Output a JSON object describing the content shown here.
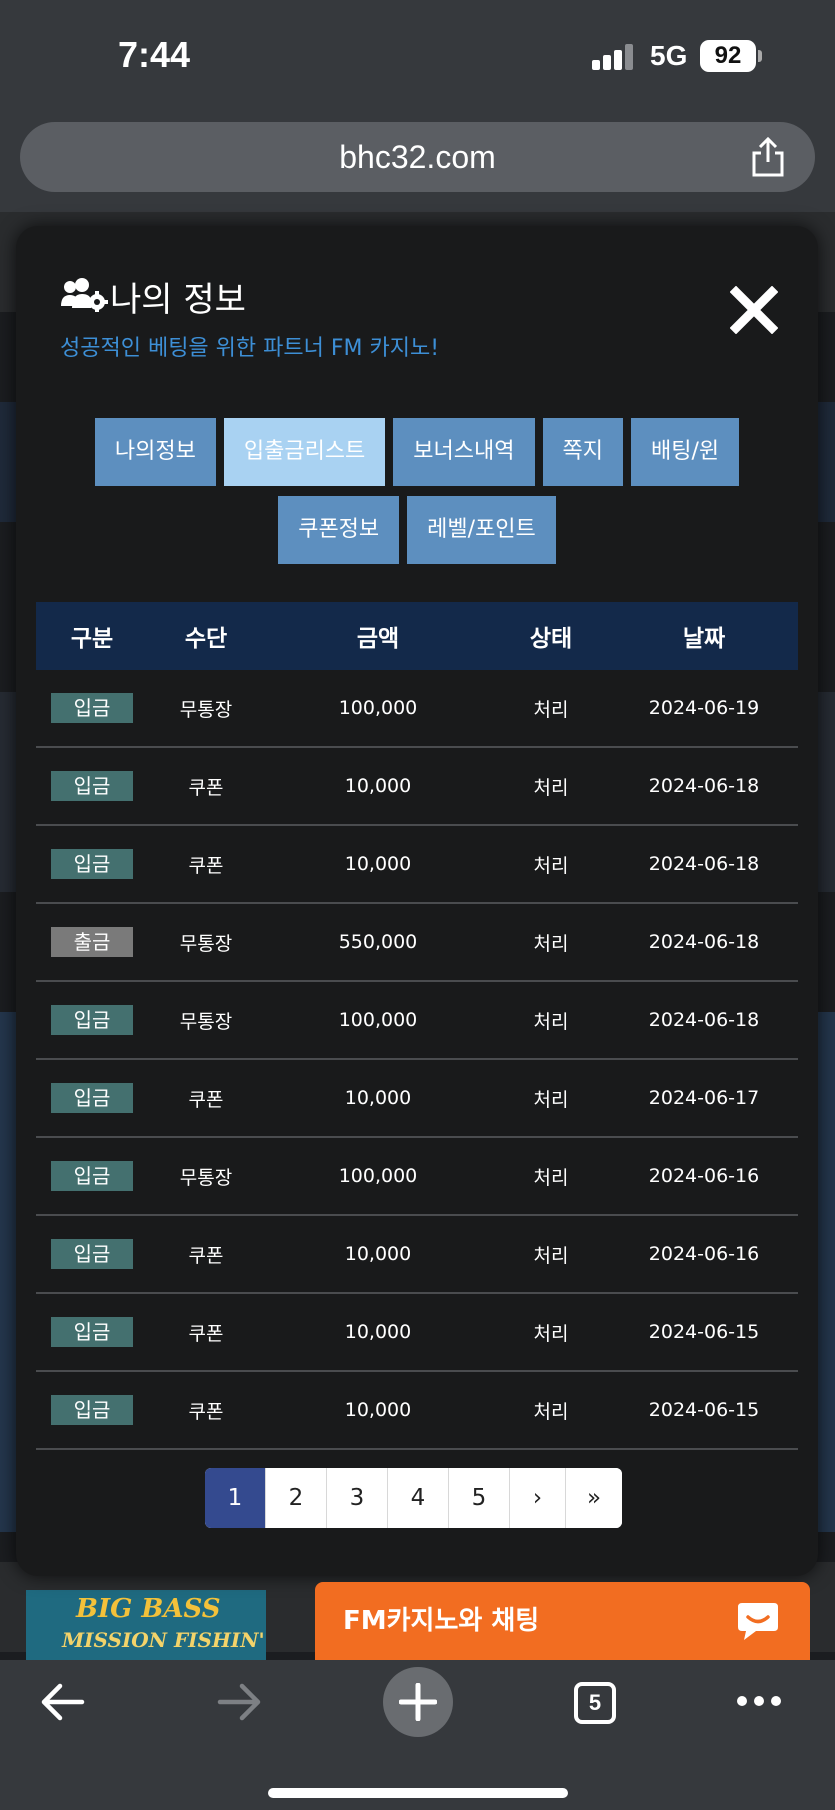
{
  "status_bar": {
    "time": "7:44",
    "network": "5G",
    "battery": "92"
  },
  "browser": {
    "url": "bhc32.com",
    "tab_count": "5"
  },
  "modal": {
    "title": "나의 정보",
    "subtitle": "성공적인 베팅을 위한 파트너 FM 카지노!",
    "tabs_row1": [
      "나의정보",
      "입출금리스트",
      "보너스내역",
      "쪽지",
      "배팅/윈"
    ],
    "tabs_row2": [
      "쿠폰정보",
      "레벨/포인트"
    ],
    "active_tab": "입출금리스트"
  },
  "table": {
    "headers": [
      "구분",
      "수단",
      "금액",
      "상태",
      "날짜"
    ],
    "rows": [
      {
        "type": "입금",
        "method": "무통장",
        "amount": "100,000",
        "status": "처리",
        "date": "2024-06-19"
      },
      {
        "type": "입금",
        "method": "쿠폰",
        "amount": "10,000",
        "status": "처리",
        "date": "2024-06-18"
      },
      {
        "type": "입금",
        "method": "쿠폰",
        "amount": "10,000",
        "status": "처리",
        "date": "2024-06-18"
      },
      {
        "type": "출금",
        "method": "무통장",
        "amount": "550,000",
        "status": "처리",
        "date": "2024-06-18"
      },
      {
        "type": "입금",
        "method": "무통장",
        "amount": "100,000",
        "status": "처리",
        "date": "2024-06-18"
      },
      {
        "type": "입금",
        "method": "쿠폰",
        "amount": "10,000",
        "status": "처리",
        "date": "2024-06-17"
      },
      {
        "type": "입금",
        "method": "무통장",
        "amount": "100,000",
        "status": "처리",
        "date": "2024-06-16"
      },
      {
        "type": "입금",
        "method": "쿠폰",
        "amount": "10,000",
        "status": "처리",
        "date": "2024-06-16"
      },
      {
        "type": "입금",
        "method": "쿠폰",
        "amount": "10,000",
        "status": "처리",
        "date": "2024-06-15"
      },
      {
        "type": "입금",
        "method": "쿠폰",
        "amount": "10,000",
        "status": "처리",
        "date": "2024-06-15"
      }
    ]
  },
  "pagination": {
    "pages": [
      "1",
      "2",
      "3",
      "4",
      "5"
    ],
    "next": "›",
    "last": "»",
    "current": "1"
  },
  "chat": {
    "label": "FM카지노와 채팅"
  },
  "background": {
    "banner_line1": "BIG BASS",
    "banner_line2": "MISSION FISHIN'"
  },
  "colors": {
    "deposit_badge": "#44706f",
    "withdraw_badge": "#7a7a7a",
    "tab": "#5d8fbf",
    "tab_active": "#a9d2f2",
    "table_header": "#13294a",
    "chat": "#f26d21",
    "page_active": "#344a8f"
  }
}
